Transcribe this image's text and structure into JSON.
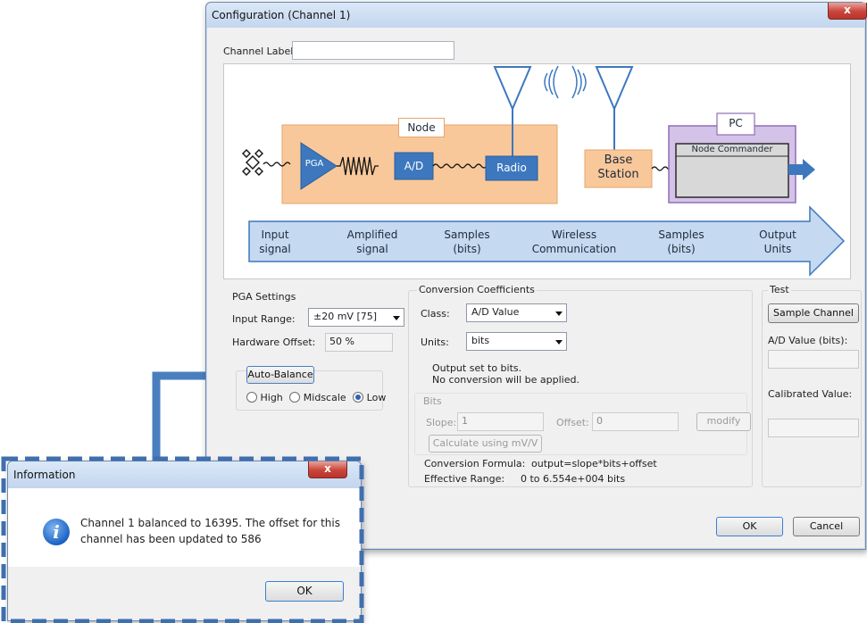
{
  "config_dialog": {
    "title": "Configuration (Channel 1)",
    "close_label": "x",
    "channel_label_caption": "Channel Label:",
    "channel_label_value": "",
    "diagram": {
      "node_label": "Node",
      "pga_label": "PGA",
      "ad_label": "A/D",
      "radio_label": "Radio",
      "base_station_label": "Base\nStation",
      "pc_label": "PC",
      "node_commander_label": "Node Commander",
      "flow_stages": [
        "Input\nsignal",
        "Amplified\nsignal",
        "Samples\n(bits)",
        "Wireless\nCommunication",
        "Samples\n(bits)",
        "Output\nUnits"
      ]
    },
    "pga_settings": {
      "title": "PGA Settings",
      "input_range_label": "Input Range:",
      "input_range_value": "±20 mV [75]",
      "hardware_offset_label": "Hardware Offset:",
      "hardware_offset_value": "50 %",
      "auto_balance_label": "Auto-Balance",
      "radio_high": "High",
      "radio_midscale": "Midscale",
      "radio_low": "Low",
      "selected_radio": "Low"
    },
    "conversion": {
      "title": "Conversion Coefficients",
      "class_label": "Class:",
      "class_value": "A/D Value",
      "units_label": "Units:",
      "units_value": "bits",
      "message_line1": "Output set to bits.",
      "message_line2": "No conversion will be applied.",
      "bits_title": "Bits",
      "slope_label": "Slope:",
      "slope_value": "1",
      "offset_label": "Offset:",
      "offset_value": "0",
      "modify_label": "modify",
      "calculate_label": "Calculate using mV/V",
      "formula_label": "Conversion Formula:",
      "formula_value": "output=slope*bits+offset",
      "range_label": "Effective Range:",
      "range_value": "0 to 6.554e+004 bits"
    },
    "test": {
      "title": "Test",
      "sample_channel_label": "Sample Channel",
      "ad_value_label": "A/D Value (bits):",
      "ad_value": "",
      "calibrated_label": "Calibrated Value:",
      "calibrated_value": ""
    },
    "ok_label": "OK",
    "cancel_label": "Cancel"
  },
  "info_dialog": {
    "title": "Information",
    "close_label": "x",
    "message_line1": "Channel 1 balanced to 16395.  The offset for this",
    "message_line2": "channel has been updated to 586",
    "ok_label": "OK",
    "icon": "info-icon"
  },
  "colors": {
    "callout_blue": "#4a7fbf",
    "node_fill": "#f9c89a",
    "pc_fill": "#d4c2e8",
    "block_blue": "#3d78be",
    "flow_arrow_fill": "#c5d9f0"
  }
}
